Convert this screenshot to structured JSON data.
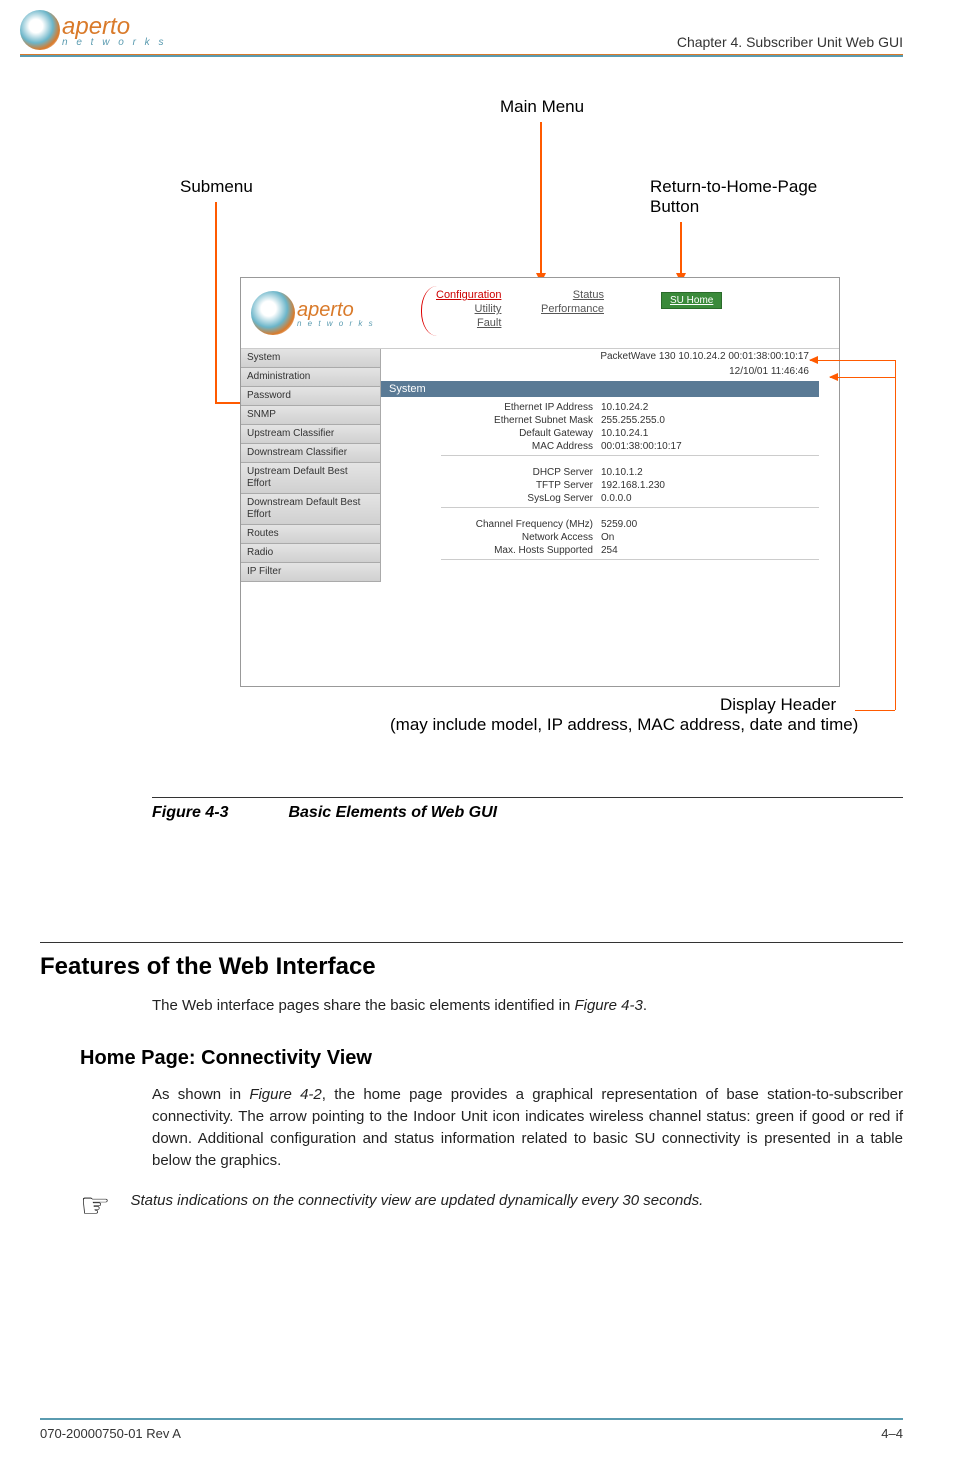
{
  "header": {
    "brand": "aperto",
    "brand_sub": "n e t w o r k s",
    "chapter": "Chapter 4.  Subscriber Unit Web GUI"
  },
  "callouts": {
    "main_menu": "Main Menu",
    "submenu": "Submenu",
    "return_home": "Return-to-Home-Page Button",
    "display_header_title": "Display Header",
    "display_header_sub": "(may include model, IP address, MAC address, date and time)"
  },
  "gui": {
    "brand": "aperto",
    "brand_sub": "n e t w o r k s",
    "menu1": {
      "a": "Configuration",
      "b": "Utility",
      "c": "Fault"
    },
    "menu2": {
      "a": "Status",
      "b": "Performance"
    },
    "su_home": "SU Home",
    "info_line1": "PacketWave 130    10.10.24.2    00:01:38:00:10:17",
    "info_line2": "12/10/01    11:46:46",
    "sidebar": [
      "System",
      "Administration",
      "Password",
      "SNMP",
      "Upstream Classifier",
      "Downstream Classifier",
      "Upstream Default Best Effort",
      "Downstream Default Best Effort",
      "Routes",
      "Radio",
      "IP Filter"
    ],
    "section_title": "System",
    "rows1": [
      {
        "label": "Ethernet IP Address",
        "value": "10.10.24.2"
      },
      {
        "label": "Ethernet Subnet Mask",
        "value": "255.255.255.0"
      },
      {
        "label": "Default Gateway",
        "value": "10.10.24.1"
      },
      {
        "label": "MAC Address",
        "value": "00:01:38:00:10:17"
      }
    ],
    "rows2": [
      {
        "label": "DHCP Server",
        "value": "10.10.1.2"
      },
      {
        "label": "TFTP Server",
        "value": "192.168.1.230"
      },
      {
        "label": "SysLog Server",
        "value": "0.0.0.0"
      }
    ],
    "rows3": [
      {
        "label": "Channel Frequency (MHz)",
        "value": "5259.00"
      },
      {
        "label": "Network Access",
        "value": "On"
      },
      {
        "label": "Max. Hosts Supported",
        "value": "254"
      }
    ]
  },
  "figure": {
    "num": "Figure 4-3",
    "title": "Basic Elements of Web GUI"
  },
  "body": {
    "h2": "Features of the Web Interface",
    "p1a": "The Web interface pages share the basic elements identified in ",
    "p1_ref": "Figure 4-3",
    "p1b": ".",
    "h3": "Home Page: Connectivity View",
    "p2a": "As shown in ",
    "p2_ref": "Figure 4-2",
    "p2b": ", the home page provides a graphical representation of base station-to-subscriber connectivity. The arrow pointing to the Indoor Unit icon indicates wireless channel status: green if good or red if down. Additional configuration and status information related to basic SU connectivity is presented in a table below the graphics.",
    "note": "Status indications on the connectivity view are updated dynamically every 30 seconds."
  },
  "footer": {
    "left": "070-20000750-01 Rev A",
    "right": "4–4"
  }
}
